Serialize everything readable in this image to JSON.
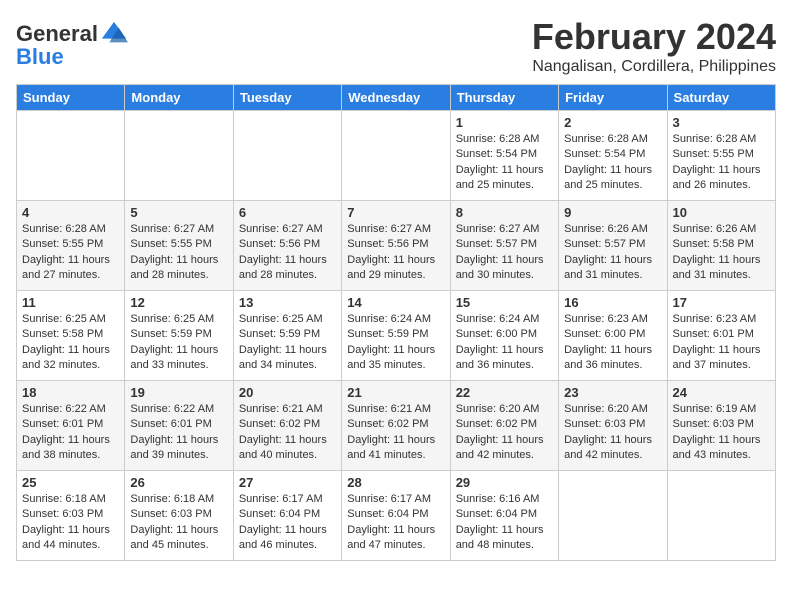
{
  "header": {
    "logo_line1": "General",
    "logo_line2": "Blue",
    "month_year": "February 2024",
    "location": "Nangalisan, Cordillera, Philippines"
  },
  "days_of_week": [
    "Sunday",
    "Monday",
    "Tuesday",
    "Wednesday",
    "Thursday",
    "Friday",
    "Saturday"
  ],
  "weeks": [
    [
      {
        "day": "",
        "sunrise": "",
        "sunset": "",
        "daylight": ""
      },
      {
        "day": "",
        "sunrise": "",
        "sunset": "",
        "daylight": ""
      },
      {
        "day": "",
        "sunrise": "",
        "sunset": "",
        "daylight": ""
      },
      {
        "day": "",
        "sunrise": "",
        "sunset": "",
        "daylight": ""
      },
      {
        "day": "1",
        "sunrise": "Sunrise: 6:28 AM",
        "sunset": "Sunset: 5:54 PM",
        "daylight": "Daylight: 11 hours and 25 minutes."
      },
      {
        "day": "2",
        "sunrise": "Sunrise: 6:28 AM",
        "sunset": "Sunset: 5:54 PM",
        "daylight": "Daylight: 11 hours and 25 minutes."
      },
      {
        "day": "3",
        "sunrise": "Sunrise: 6:28 AM",
        "sunset": "Sunset: 5:55 PM",
        "daylight": "Daylight: 11 hours and 26 minutes."
      }
    ],
    [
      {
        "day": "4",
        "sunrise": "Sunrise: 6:28 AM",
        "sunset": "Sunset: 5:55 PM",
        "daylight": "Daylight: 11 hours and 27 minutes."
      },
      {
        "day": "5",
        "sunrise": "Sunrise: 6:27 AM",
        "sunset": "Sunset: 5:55 PM",
        "daylight": "Daylight: 11 hours and 28 minutes."
      },
      {
        "day": "6",
        "sunrise": "Sunrise: 6:27 AM",
        "sunset": "Sunset: 5:56 PM",
        "daylight": "Daylight: 11 hours and 28 minutes."
      },
      {
        "day": "7",
        "sunrise": "Sunrise: 6:27 AM",
        "sunset": "Sunset: 5:56 PM",
        "daylight": "Daylight: 11 hours and 29 minutes."
      },
      {
        "day": "8",
        "sunrise": "Sunrise: 6:27 AM",
        "sunset": "Sunset: 5:57 PM",
        "daylight": "Daylight: 11 hours and 30 minutes."
      },
      {
        "day": "9",
        "sunrise": "Sunrise: 6:26 AM",
        "sunset": "Sunset: 5:57 PM",
        "daylight": "Daylight: 11 hours and 31 minutes."
      },
      {
        "day": "10",
        "sunrise": "Sunrise: 6:26 AM",
        "sunset": "Sunset: 5:58 PM",
        "daylight": "Daylight: 11 hours and 31 minutes."
      }
    ],
    [
      {
        "day": "11",
        "sunrise": "Sunrise: 6:25 AM",
        "sunset": "Sunset: 5:58 PM",
        "daylight": "Daylight: 11 hours and 32 minutes."
      },
      {
        "day": "12",
        "sunrise": "Sunrise: 6:25 AM",
        "sunset": "Sunset: 5:59 PM",
        "daylight": "Daylight: 11 hours and 33 minutes."
      },
      {
        "day": "13",
        "sunrise": "Sunrise: 6:25 AM",
        "sunset": "Sunset: 5:59 PM",
        "daylight": "Daylight: 11 hours and 34 minutes."
      },
      {
        "day": "14",
        "sunrise": "Sunrise: 6:24 AM",
        "sunset": "Sunset: 5:59 PM",
        "daylight": "Daylight: 11 hours and 35 minutes."
      },
      {
        "day": "15",
        "sunrise": "Sunrise: 6:24 AM",
        "sunset": "Sunset: 6:00 PM",
        "daylight": "Daylight: 11 hours and 36 minutes."
      },
      {
        "day": "16",
        "sunrise": "Sunrise: 6:23 AM",
        "sunset": "Sunset: 6:00 PM",
        "daylight": "Daylight: 11 hours and 36 minutes."
      },
      {
        "day": "17",
        "sunrise": "Sunrise: 6:23 AM",
        "sunset": "Sunset: 6:01 PM",
        "daylight": "Daylight: 11 hours and 37 minutes."
      }
    ],
    [
      {
        "day": "18",
        "sunrise": "Sunrise: 6:22 AM",
        "sunset": "Sunset: 6:01 PM",
        "daylight": "Daylight: 11 hours and 38 minutes."
      },
      {
        "day": "19",
        "sunrise": "Sunrise: 6:22 AM",
        "sunset": "Sunset: 6:01 PM",
        "daylight": "Daylight: 11 hours and 39 minutes."
      },
      {
        "day": "20",
        "sunrise": "Sunrise: 6:21 AM",
        "sunset": "Sunset: 6:02 PM",
        "daylight": "Daylight: 11 hours and 40 minutes."
      },
      {
        "day": "21",
        "sunrise": "Sunrise: 6:21 AM",
        "sunset": "Sunset: 6:02 PM",
        "daylight": "Daylight: 11 hours and 41 minutes."
      },
      {
        "day": "22",
        "sunrise": "Sunrise: 6:20 AM",
        "sunset": "Sunset: 6:02 PM",
        "daylight": "Daylight: 11 hours and 42 minutes."
      },
      {
        "day": "23",
        "sunrise": "Sunrise: 6:20 AM",
        "sunset": "Sunset: 6:03 PM",
        "daylight": "Daylight: 11 hours and 42 minutes."
      },
      {
        "day": "24",
        "sunrise": "Sunrise: 6:19 AM",
        "sunset": "Sunset: 6:03 PM",
        "daylight": "Daylight: 11 hours and 43 minutes."
      }
    ],
    [
      {
        "day": "25",
        "sunrise": "Sunrise: 6:18 AM",
        "sunset": "Sunset: 6:03 PM",
        "daylight": "Daylight: 11 hours and 44 minutes."
      },
      {
        "day": "26",
        "sunrise": "Sunrise: 6:18 AM",
        "sunset": "Sunset: 6:03 PM",
        "daylight": "Daylight: 11 hours and 45 minutes."
      },
      {
        "day": "27",
        "sunrise": "Sunrise: 6:17 AM",
        "sunset": "Sunset: 6:04 PM",
        "daylight": "Daylight: 11 hours and 46 minutes."
      },
      {
        "day": "28",
        "sunrise": "Sunrise: 6:17 AM",
        "sunset": "Sunset: 6:04 PM",
        "daylight": "Daylight: 11 hours and 47 minutes."
      },
      {
        "day": "29",
        "sunrise": "Sunrise: 6:16 AM",
        "sunset": "Sunset: 6:04 PM",
        "daylight": "Daylight: 11 hours and 48 minutes."
      },
      {
        "day": "",
        "sunrise": "",
        "sunset": "",
        "daylight": ""
      },
      {
        "day": "",
        "sunrise": "",
        "sunset": "",
        "daylight": ""
      }
    ]
  ]
}
